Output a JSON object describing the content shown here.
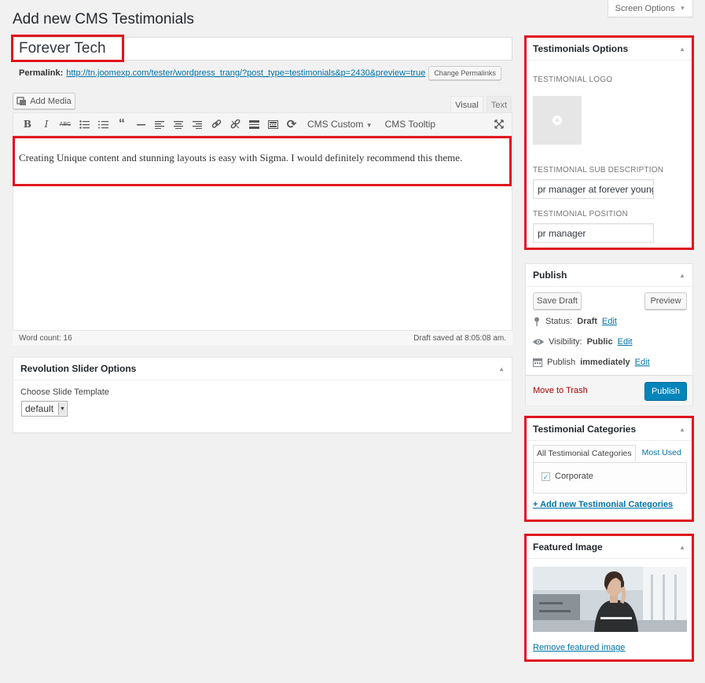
{
  "header": {
    "title": "Add new CMS Testimonials",
    "screen_options": "Screen Options"
  },
  "post": {
    "title": "Forever Tech",
    "permalink_label": "Permalink:",
    "permalink_url": "http://tn.joomexp.com/tester/wordpress_trang/?post_type=testimonials&p=2430&preview=true",
    "change_permalinks": "Change Permalinks"
  },
  "editor": {
    "add_media": "Add Media",
    "tab_visual": "Visual",
    "tab_text": "Text",
    "toolbar": {
      "cms_custom": "CMS Custom",
      "cms_tooltip": "CMS Tooltip"
    },
    "content": "Creating Unique content and stunning layouts is easy with Sigma. I would definitely recommend this theme.",
    "word_count": "Word count: 16",
    "draft_saved": "Draft saved at 8:05:08 am."
  },
  "revolution_slider": {
    "title": "Revolution Slider Options",
    "choose_label": "Choose Slide Template",
    "selected": "default"
  },
  "testimonials_options": {
    "title": "Testimonials Options",
    "logo_label": "TESTIMONIAL LOGO",
    "sub_desc_label": "TESTIMONIAL SUB DESCRIPTION",
    "sub_desc_value": "pr manager at forever young",
    "position_label": "TESTIMONIAL POSITION",
    "position_value": "pr manager"
  },
  "publish": {
    "title": "Publish",
    "save_draft": "Save Draft",
    "preview": "Preview",
    "status_label": "Status:",
    "status_value": "Draft",
    "visibility_label": "Visibility:",
    "visibility_value": "Public",
    "publish_label": "Publish",
    "publish_value": "immediately",
    "edit": "Edit",
    "move_to_trash": "Move to Trash",
    "publish_button": "Publish"
  },
  "categories": {
    "title": "Testimonial Categories",
    "tab_all": "All Testimonial Categories",
    "tab_most_used": "Most Used",
    "items": [
      {
        "label": "Corporate",
        "checked": true
      }
    ],
    "add_new": "+ Add new Testimonial Categories"
  },
  "featured_image": {
    "title": "Featured Image",
    "remove": "Remove featured image"
  },
  "colors": {
    "highlight": "#e0141e",
    "primary_button": "#0085ba",
    "link": "#0073aa",
    "trash": "#a00"
  }
}
